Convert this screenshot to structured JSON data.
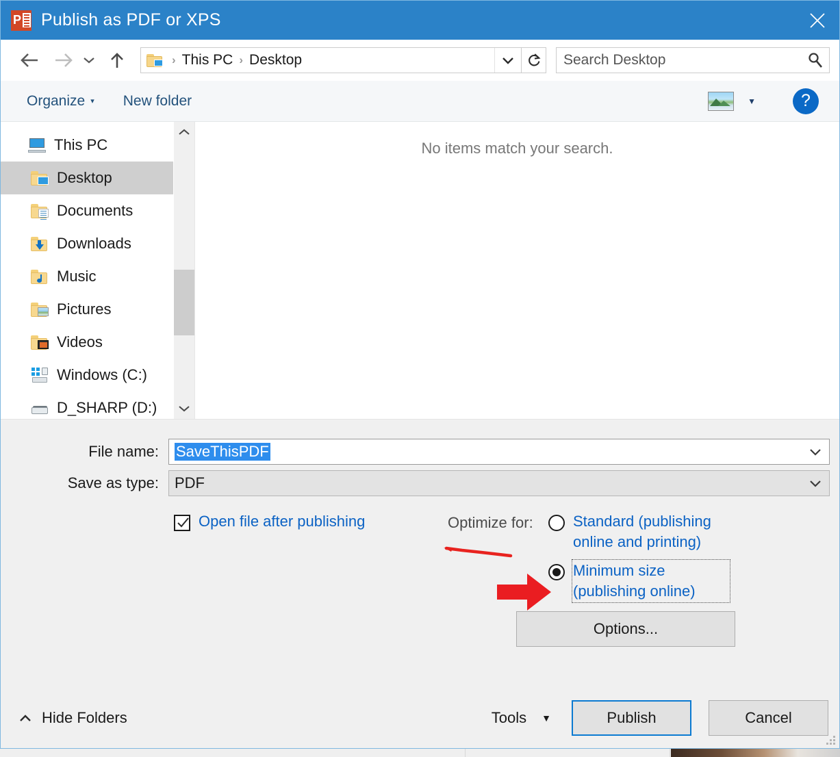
{
  "window": {
    "title": "Publish as PDF or XPS",
    "app_icon": "powerpoint-icon",
    "close_label": "✕",
    "titlebar_color": "#2b82c8",
    "accent_color": "#0b7ad1"
  },
  "navigation": {
    "back_icon": "arrow-left-icon",
    "forward_icon": "arrow-right-icon",
    "recent_icon": "chevron-down-icon",
    "up_icon": "arrow-up-icon",
    "address": {
      "folder_icon": "desktop-folder-icon",
      "separator": "›",
      "crumbs": [
        "This PC",
        "Desktop"
      ],
      "dropdown_icon": "chevron-down-icon"
    },
    "refresh_icon": "refresh-icon",
    "search": {
      "placeholder": "Search Desktop",
      "value": "",
      "icon": "search-icon"
    }
  },
  "toolbar": {
    "organize_label": "Organize",
    "organize_caret": "▾",
    "new_folder_label": "New folder",
    "view_icon": "picture-view-icon",
    "view_caret": "▼",
    "help_label": "?"
  },
  "sidebar": {
    "items": [
      {
        "label": "This PC",
        "icon": "this-pc-icon",
        "selected": false,
        "indent": "root"
      },
      {
        "label": "Desktop",
        "icon": "desktop-folder-icon",
        "selected": true,
        "indent": "child"
      },
      {
        "label": "Documents",
        "icon": "documents-folder-icon",
        "selected": false,
        "indent": "child"
      },
      {
        "label": "Downloads",
        "icon": "downloads-folder-icon",
        "selected": false,
        "indent": "child"
      },
      {
        "label": "Music",
        "icon": "music-folder-icon",
        "selected": false,
        "indent": "child"
      },
      {
        "label": "Pictures",
        "icon": "pictures-folder-icon",
        "selected": false,
        "indent": "child"
      },
      {
        "label": "Videos",
        "icon": "videos-folder-icon",
        "selected": false,
        "indent": "child"
      },
      {
        "label": "Windows (C:)",
        "icon": "windows-drive-icon",
        "selected": false,
        "indent": "child"
      },
      {
        "label": "D_SHARP (D:)",
        "icon": "hard-drive-icon",
        "selected": false,
        "indent": "child"
      }
    ],
    "scrollbar": {
      "up_icon": "chevron-up-icon",
      "down_icon": "chevron-down-icon"
    }
  },
  "filelist": {
    "empty_message": "No items match your search."
  },
  "form": {
    "filename": {
      "label": "File name:",
      "value": "SaveThisPDF",
      "selected": true,
      "dropdown_icon": "chevron-down-icon"
    },
    "savetype": {
      "label": "Save as type:",
      "value": "PDF",
      "dropdown_icon": "chevron-down-icon",
      "disabled": true
    },
    "open_after_publishing": {
      "label": "Open file after publishing",
      "checked": true
    },
    "optimize": {
      "label": "Optimize for:",
      "options": [
        {
          "label": "Standard (publishing online and printing)",
          "selected": false,
          "focused": false
        },
        {
          "label": "Minimum size (publishing online)",
          "selected": true,
          "focused": true
        }
      ]
    },
    "options_button": "Options..."
  },
  "annotations": {
    "squiggle_color": "#e8231f",
    "arrow_color": "#ea1d21",
    "squiggle_name": "red-underline-annotation",
    "arrow_name": "red-pointer-arrow-annotation"
  },
  "footer": {
    "hide_folders_label": "Hide Folders",
    "hide_folders_icon": "chevron-up-icon",
    "tools_label": "Tools",
    "tools_caret": "▼",
    "publish_label": "Publish",
    "cancel_label": "Cancel",
    "resize_grip": "resize-grip-icon"
  }
}
